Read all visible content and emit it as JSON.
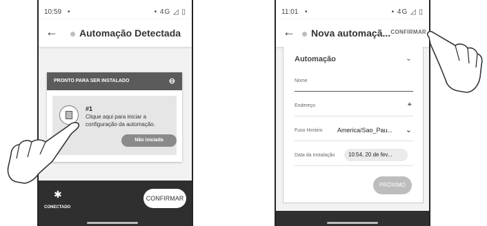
{
  "phone1": {
    "status": {
      "time": "10:59",
      "dot": "•",
      "right": "• 4G ◿ ▯"
    },
    "appbar": {
      "back": "←",
      "title": "Automação Detectada"
    },
    "card": {
      "header": "PRONTO PARA SER INSTALADO",
      "link_icon": "⊖",
      "number": "#1",
      "description": "Clique aqui para iniciar a configuração da automação.",
      "status_pill": "Não iniciada"
    },
    "bottom": {
      "bt_icon": "✱",
      "connected_label": "CONECTADO",
      "confirm": "CONFIRMAR"
    }
  },
  "phone2": {
    "status": {
      "time": "11:01",
      "dot": "•",
      "right": "• 4G ◿ ▯"
    },
    "appbar": {
      "back": "←",
      "title": "Nova automaçã...",
      "confirm": "CONFIRMAR"
    },
    "form": {
      "section_title": "Automação",
      "chevron": "⌄",
      "name_label": "Nome",
      "address_label": "Endereço",
      "timezone_label": "Fuso Horário",
      "timezone_value": "America/Sao_Pau...",
      "timezone_chevron": "⌄",
      "install_date_label": "Data da Instalação",
      "install_date_value": "10:54, 20 de fev...",
      "next": "PRÓXIMO"
    }
  },
  "icons": {
    "back": "arrow-left-icon",
    "link": "link-icon",
    "bluetooth": "bluetooth-icon",
    "target": "crosshair-icon",
    "hand": "pointing-hand-icon"
  }
}
